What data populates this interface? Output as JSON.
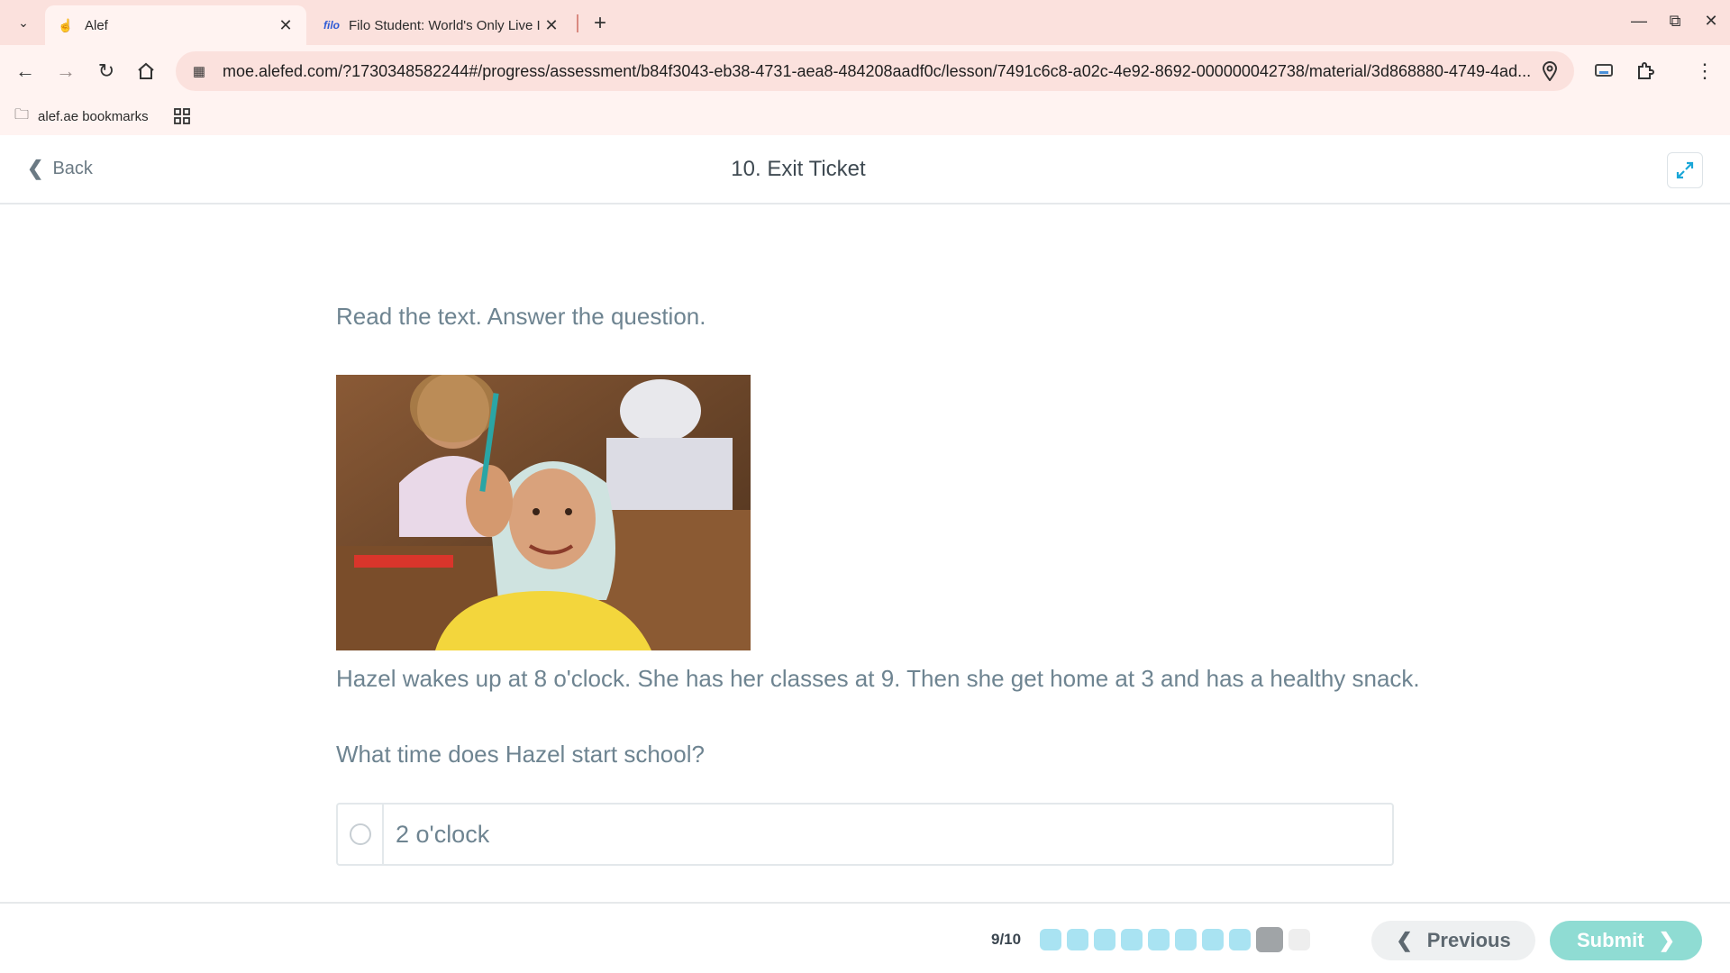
{
  "browser": {
    "tabs": [
      {
        "title": "Alef",
        "icon": "alef-logo-icon",
        "active": true
      },
      {
        "title": "Filo Student: World's Only Live I",
        "icon": "filo-logo-icon",
        "favicon_text": "filo",
        "active": false
      }
    ],
    "url": "moe.alefed.com/?1730348582244#/progress/assessment/b84f3043-eb38-4731-aea8-484208aadf0c/lesson/7491c6c8-a02c-4e92-8692-000000042738/material/3d868880-4749-4ad...",
    "bookmarks": [
      {
        "label": "alef.ae bookmarks",
        "icon": "bookmark-folder-icon"
      }
    ],
    "colors": {
      "tabbar": "#fbe1dd",
      "toolbar": "#fff3f1"
    }
  },
  "header": {
    "back_label": "Back",
    "title": "10. Exit Ticket"
  },
  "lesson": {
    "instructions": "Read the text. Answer the question.",
    "image_subject": "smiling girl in headscarf holding a pencil in a classroom",
    "passage": "Hazel wakes up at 8 o'clock. She has her classes at 9. Then she get home at 3 and has a healthy snack.",
    "question": "What time does Hazel start school?",
    "options": [
      {
        "label": "2 o'clock",
        "selected": false
      }
    ]
  },
  "footer": {
    "progress_text": "9/10",
    "progress": {
      "current": 9,
      "total": 10,
      "completed": 8
    },
    "previous_label": "Previous",
    "submit_label": "Submit",
    "colors": {
      "dot_done": "#a9e3f2",
      "dot_current": "#a0a4a7",
      "submit": "#8fdcd3"
    }
  }
}
